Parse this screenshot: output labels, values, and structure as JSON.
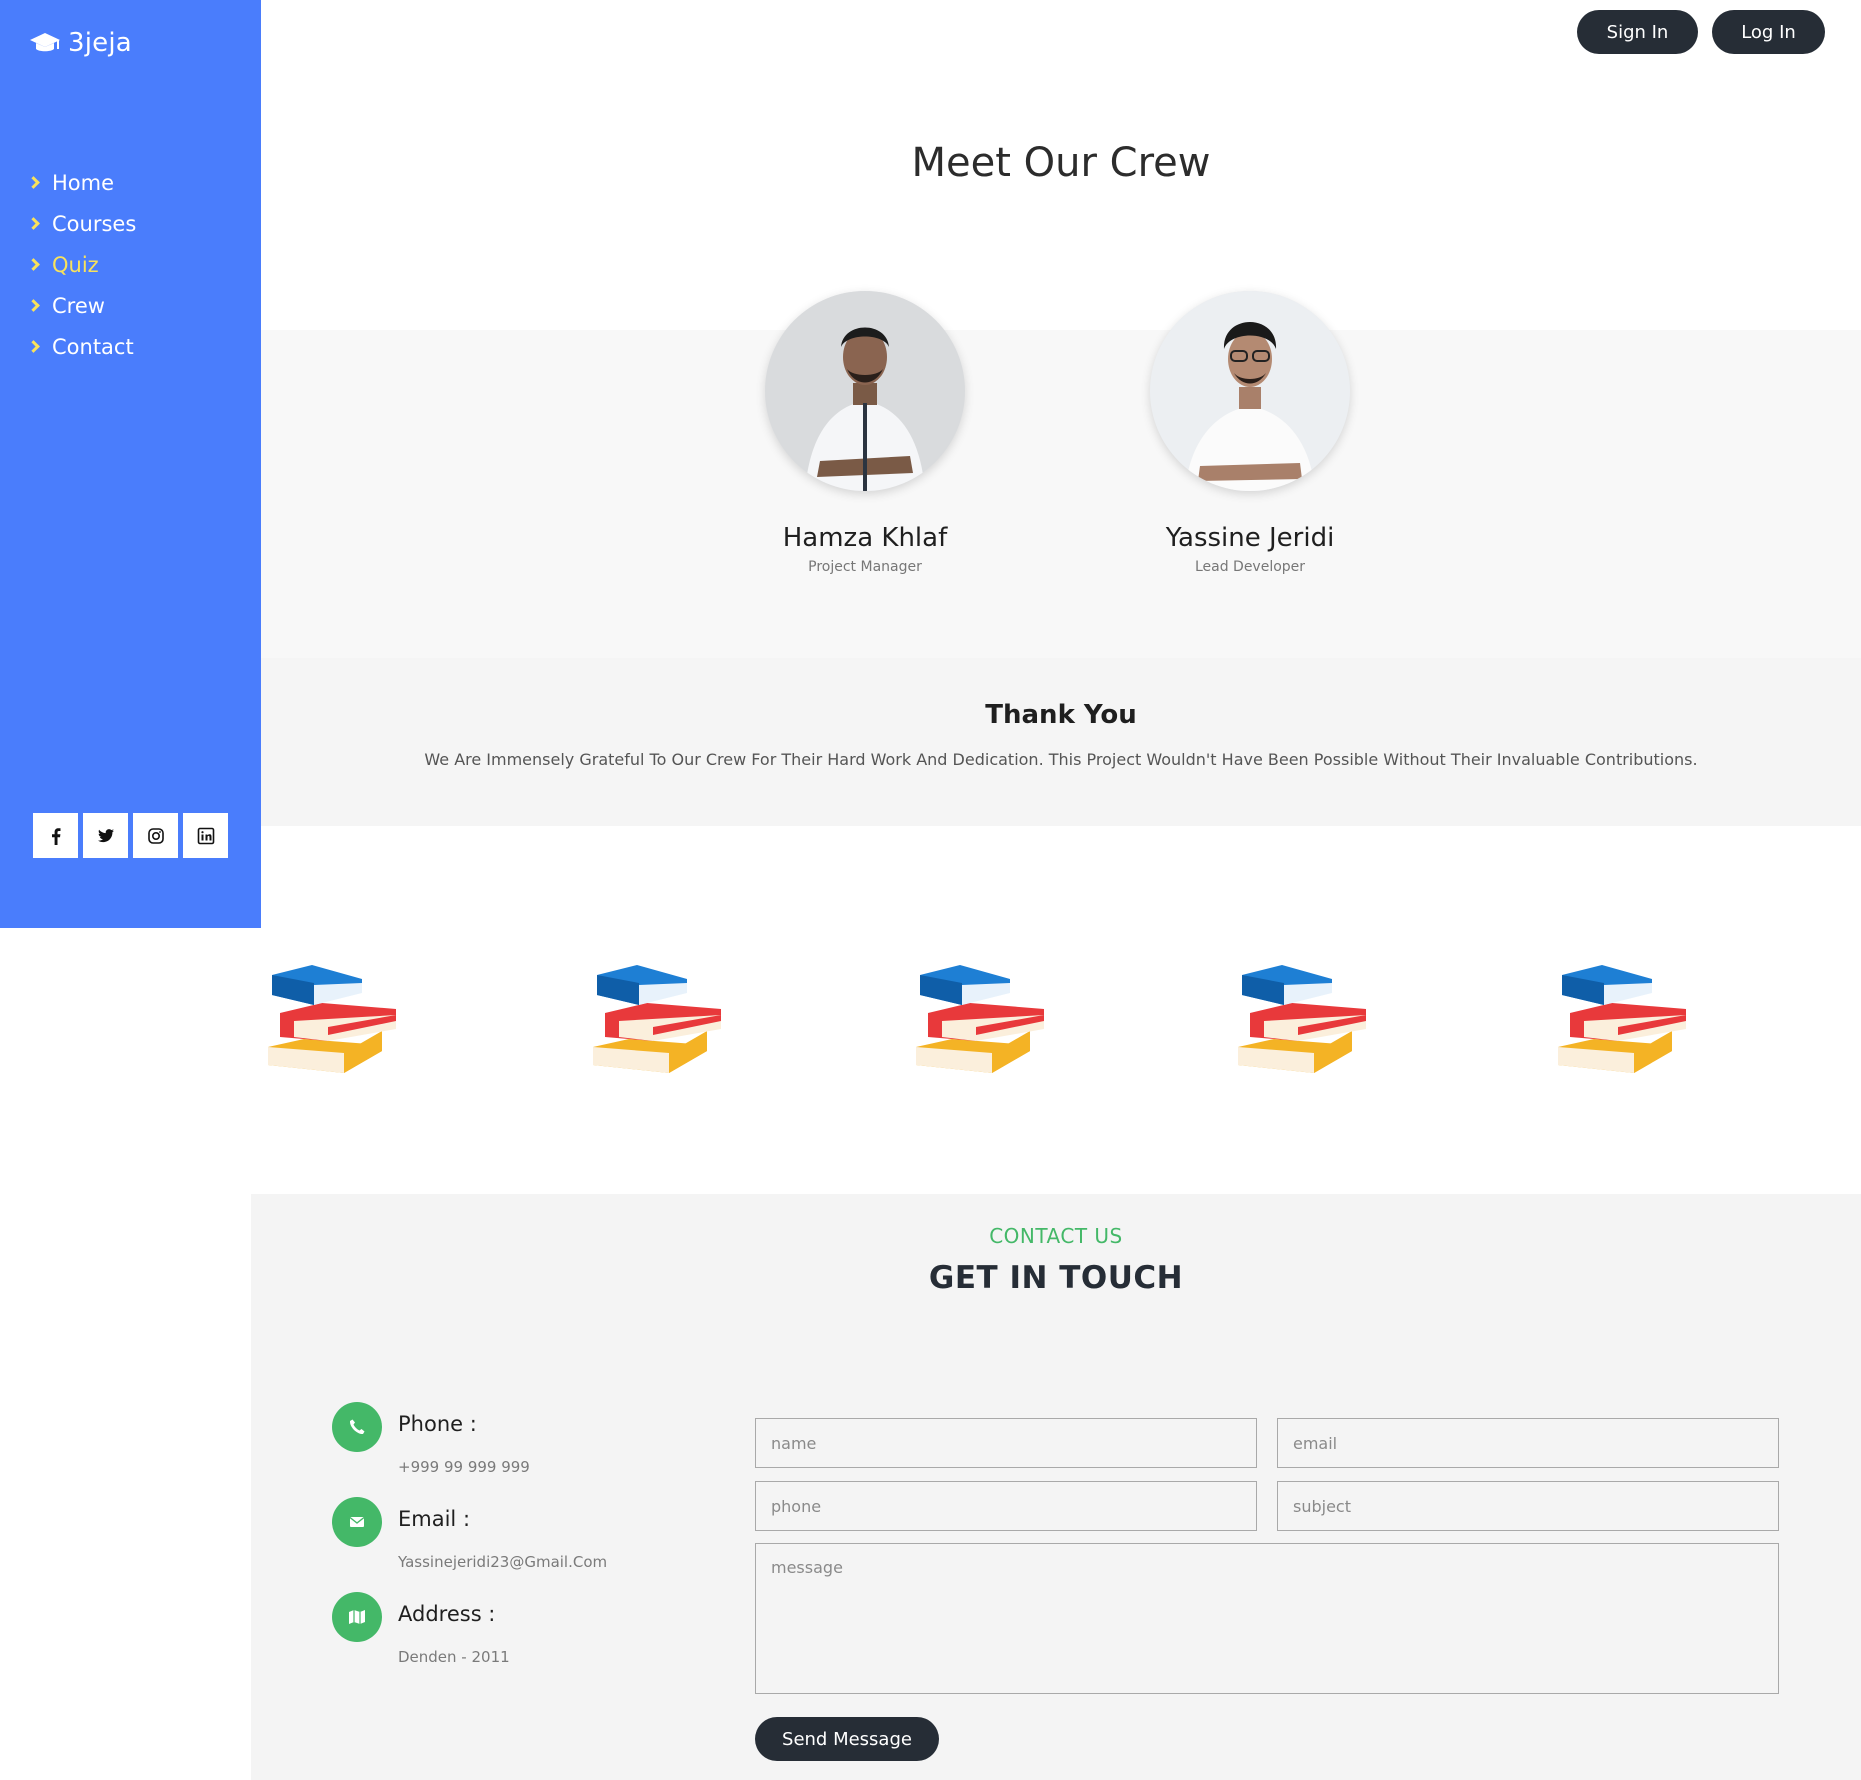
{
  "brand": {
    "name": "3jeja",
    "icon": "graduation-cap-icon"
  },
  "nav": {
    "items": [
      {
        "label": "Home",
        "active": false
      },
      {
        "label": "Courses",
        "active": false
      },
      {
        "label": "Quiz",
        "active": true
      },
      {
        "label": "Crew",
        "active": false
      },
      {
        "label": "Contact",
        "active": false
      }
    ]
  },
  "socials": [
    "facebook-icon",
    "twitter-icon",
    "instagram-icon",
    "linkedin-icon"
  ],
  "header": {
    "signin_label": "Sign In",
    "login_label": "Log In"
  },
  "crew": {
    "title": "Meet Our Crew",
    "members": [
      {
        "name": "Hamza Khlaf",
        "role": "Project Manager"
      },
      {
        "name": "Yassine Jeridi",
        "role": "Lead Developer"
      }
    ]
  },
  "thanks": {
    "title": "Thank You",
    "text": "We Are Immensely Grateful To Our Crew For Their Hard Work And Dedication. This Project Wouldn't Have Been Possible Without Their Invaluable Contributions."
  },
  "books": {
    "count": 5,
    "icon": "books-stack-icon"
  },
  "contact": {
    "kicker": "CONTACT US",
    "title": "GET IN TOUCH",
    "info": [
      {
        "label": "Phone :",
        "value": "+999 99 999 999",
        "icon": "phone-icon"
      },
      {
        "label": "Email :",
        "value": "Yassinejeridi23@Gmail.Com",
        "icon": "envelope-icon"
      },
      {
        "label": "Address :",
        "value": "Denden - 2011",
        "icon": "map-icon"
      }
    ],
    "form": {
      "name_placeholder": "name",
      "email_placeholder": "email",
      "phone_placeholder": "phone",
      "subject_placeholder": "subject",
      "message_placeholder": "message",
      "send_label": "Send Message"
    }
  },
  "colors": {
    "sidebar": "#4a7dfc",
    "active_nav": "#f8e25c",
    "dark_button": "#262d36",
    "accent_green": "#44b868"
  }
}
